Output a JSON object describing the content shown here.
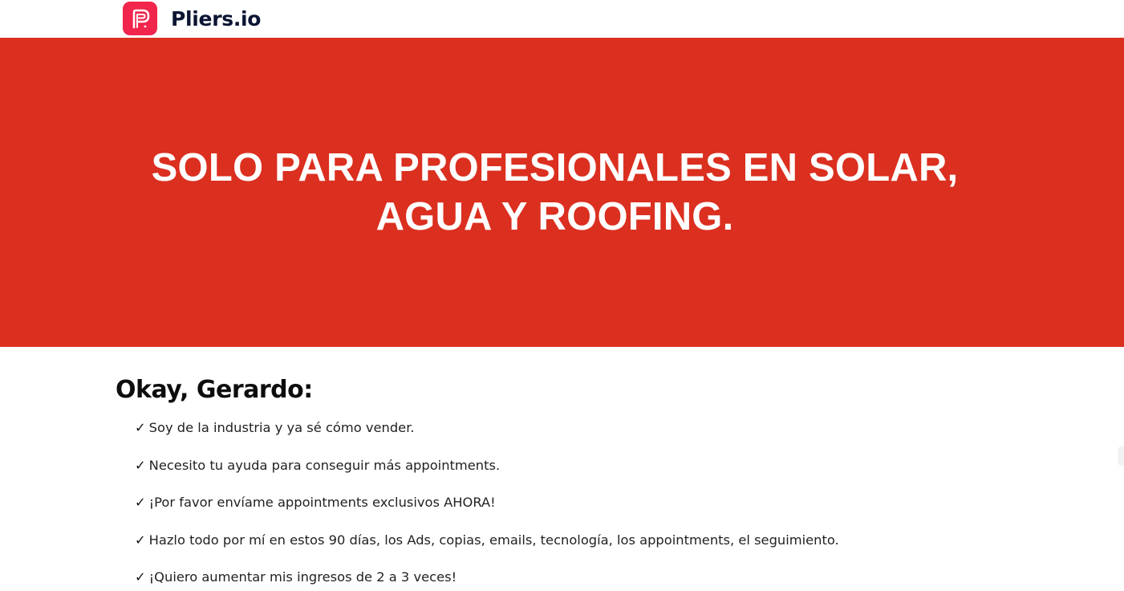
{
  "header": {
    "brand_name": "Pliers.io",
    "logo_icon": "pliers-p-logo-icon",
    "logo_color": "#f2254c"
  },
  "hero": {
    "title": "SOLO PARA PROFESIONALES EN SOLAR, AGUA Y ROOFING.",
    "background_color": "#db2f1f"
  },
  "main": {
    "greeting": "Okay, Gerardo:",
    "check_symbol": "✓",
    "items": [
      "Soy de la industria y ya sé cómo vender.",
      "Necesito tu ayuda para conseguir más appointments.",
      "¡Por favor envíame appointments exclusivos AHORA!",
      "Hazlo todo por mí en estos 90 días, los Ads, copias, emails, tecnología, los appointments, el seguimiento.",
      "¡Quiero aumentar mis ingresos de 2 a 3 veces!"
    ]
  }
}
